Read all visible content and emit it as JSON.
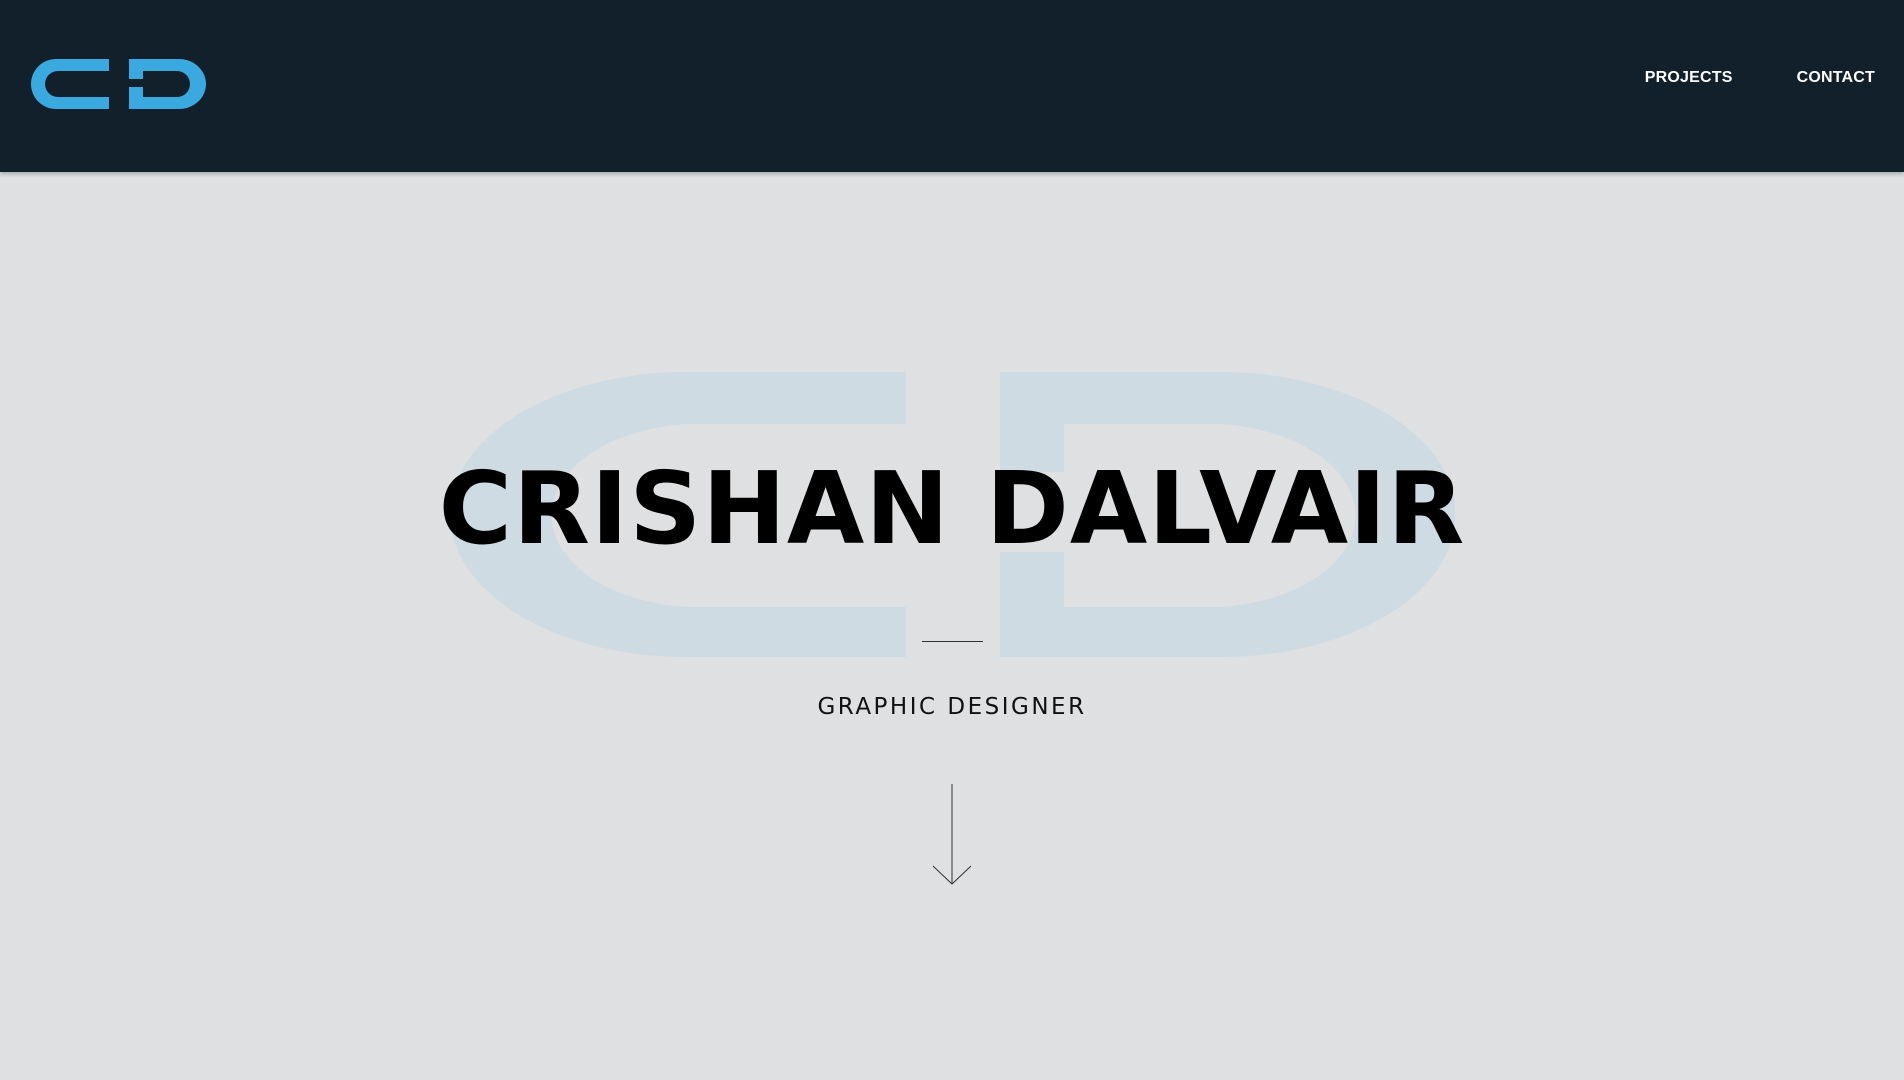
{
  "header": {
    "logo_label": "CD",
    "nav": {
      "projects_label": "PROJECTS",
      "contact_label": "CONTACT"
    }
  },
  "hero": {
    "title": "CRISHAN DALVAIR",
    "subtitle": "GRAPHIC DESIGNER",
    "scroll_icon": "arrow-down-icon"
  },
  "colors": {
    "header_bg": "#12202c",
    "accent": "#3aa9e0",
    "page_bg": "#dfe0e2",
    "watermark": "#cfdbe3"
  }
}
